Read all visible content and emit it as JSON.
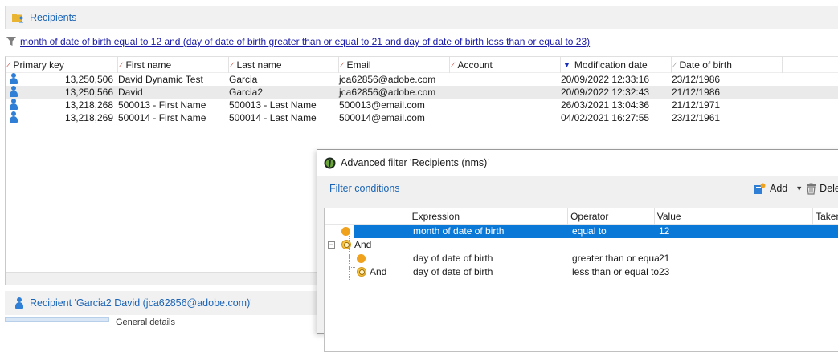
{
  "window": {
    "title": "Recipients",
    "folder_icon": "folder-people-icon"
  },
  "filter": {
    "text": "month of date of birth equal to 12 and (day of date of birth greater than or equal to 21 and day of date of birth less than or equal to 23)"
  },
  "grid": {
    "columns": [
      {
        "label": "Primary key",
        "sort": "none"
      },
      {
        "label": "First name",
        "sort": "none"
      },
      {
        "label": "Last name",
        "sort": "none"
      },
      {
        "label": "Email",
        "sort": "none"
      },
      {
        "label": "Account",
        "sort": "none"
      },
      {
        "label": "Modification date",
        "sort": "desc"
      },
      {
        "label": "Date of birth",
        "sort": "none"
      }
    ],
    "rows": [
      {
        "primary_key": "13,250,506",
        "first_name": "David Dynamic Test",
        "last_name": "Garcia",
        "email": "jca62856@adobe.com",
        "account": "",
        "modification_date": "20/09/2022 12:33:16",
        "date_of_birth": "23/12/1986",
        "selected": false
      },
      {
        "primary_key": "13,250,566",
        "first_name": "David",
        "last_name": "Garcia2",
        "email": "jca62856@adobe.com",
        "account": "",
        "modification_date": "20/09/2022 12:32:43",
        "date_of_birth": "21/12/1986",
        "selected": true
      },
      {
        "primary_key": "13,218,268",
        "first_name": "500013 - First Name",
        "last_name": "500013 - Last Name",
        "email": "500013@email.com",
        "account": "",
        "modification_date": "26/03/2021 13:04:36",
        "date_of_birth": "21/12/1971",
        "selected": false
      },
      {
        "primary_key": "13,218,269",
        "first_name": "500014 - First Name",
        "last_name": "500014 - Last Name",
        "email": "500014@email.com",
        "account": "",
        "modification_date": "04/02/2021 16:27:55",
        "date_of_birth": "23/12/1961",
        "selected": false
      }
    ]
  },
  "detail": {
    "title": "Recipient 'Garcia2 David (jca62856@adobe.com)'",
    "tab_label": "General details"
  },
  "dialog": {
    "title": "Advanced filter 'Recipients (nms)'",
    "section_title": "Filter conditions",
    "toolbar": {
      "add_label": "Add",
      "delete_label": "Dele"
    },
    "columns": [
      "Expression",
      "Operator",
      "Value",
      "Taken"
    ],
    "conditions": [
      {
        "kind": "condition",
        "indent": 0,
        "expression": "month of date of birth",
        "operator": "equal to",
        "value": "12",
        "selected": true
      },
      {
        "kind": "group",
        "indent": 0,
        "label": "And"
      },
      {
        "kind": "condition",
        "indent": 1,
        "expression": "day of date of birth",
        "operator": "greater than or equa",
        "value": "21",
        "selected": false
      },
      {
        "kind": "condition",
        "indent": 1,
        "label": "And",
        "expression": "day of date of birth",
        "operator": "less than or equal to",
        "value": "23",
        "selected": false
      }
    ]
  },
  "colors": {
    "link": "#1a1aa6",
    "accent": "#1a63b5",
    "selection": "#0a78d7",
    "condition_dot": "#f0a21c",
    "person_icon": "#2f7fd6"
  }
}
